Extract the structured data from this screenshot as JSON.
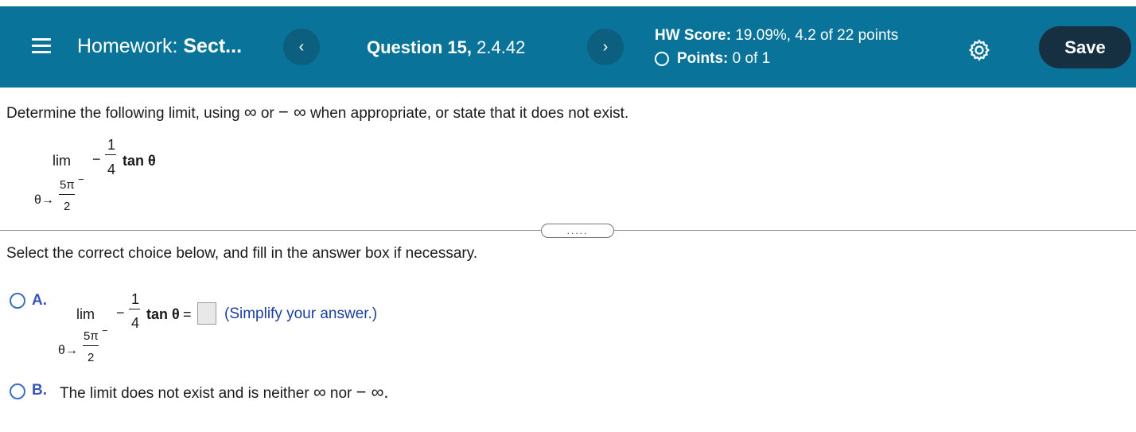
{
  "header": {
    "homework_prefix": "Homework:",
    "homework_name": "Sect...",
    "question_bold": "Question 15,",
    "question_id": "2.4.42",
    "prev_icon": "‹",
    "next_icon": "›",
    "score_label": "HW Score:",
    "score_value": "19.09%, 4.2 of 22 points",
    "points_label": "Points:",
    "points_value": "0 of 1",
    "save_label": "Save",
    "icons": [
      "menu-icon",
      "chevron-left-icon",
      "chevron-right-icon",
      "circle-icon",
      "gear-icon"
    ],
    "bg_color": "#0a7399"
  },
  "question": {
    "prompt_1": "Determine the following limit, using",
    "inf": "∞",
    "or": "or",
    "neg_inf": "− ∞",
    "prompt_2": "when appropriate, or state that it does not exist.",
    "expr": {
      "lim": "lim",
      "minus": "−",
      "num": "1",
      "den": "4",
      "func": "tan θ",
      "sub_var": "θ→",
      "sub_num": "5π",
      "sub_den": "2",
      "sub_sup": "−"
    }
  },
  "expand_dots": ".....",
  "select_prompt": "Select the correct choice below, and fill in the answer box if necessary.",
  "options": {
    "a": {
      "label": "A.",
      "equals": "=",
      "answer_value": "",
      "hint": "(Simplify your answer.)"
    },
    "b": {
      "label": "B.",
      "text_1": "The limit does not exist and is neither",
      "inf": "∞",
      "nor": "nor",
      "neg_inf": "− ∞."
    }
  }
}
